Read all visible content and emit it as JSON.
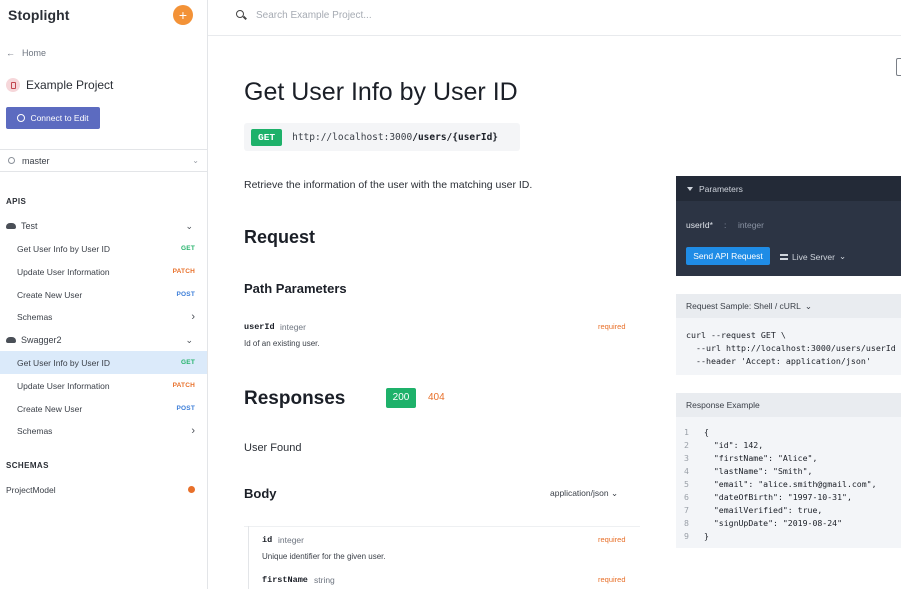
{
  "sidebar": {
    "brand": "Stoplight",
    "add_label": "+",
    "home_label": "Home",
    "project_name": "Example Project",
    "connect_label": "Connect to Edit",
    "branch": "master",
    "apis_heading": "APIS",
    "schemas_heading": "SCHEMAS",
    "groups": [
      {
        "name": "Test",
        "items": [
          {
            "label": "Get User Info by User ID",
            "method": "GET"
          },
          {
            "label": "Update User Information",
            "method": "PATCH"
          },
          {
            "label": "Create New User",
            "method": "POST"
          },
          {
            "label": "Schemas",
            "method": ""
          }
        ]
      },
      {
        "name": "Swagger2",
        "items": [
          {
            "label": "Get User Info by User ID",
            "method": "GET"
          },
          {
            "label": "Update User Information",
            "method": "PATCH"
          },
          {
            "label": "Create New User",
            "method": "POST"
          },
          {
            "label": "Schemas",
            "method": ""
          }
        ]
      }
    ],
    "models": [
      {
        "label": "ProjectModel"
      }
    ]
  },
  "search": {
    "placeholder": "Search Example Project..."
  },
  "main": {
    "title": "Get User Info by User ID",
    "method": "GET",
    "url_base": "http://localhost:3000",
    "url_path": "/users/{userId}",
    "description": "Retrieve the information of the user with the matching user ID.",
    "request_heading": "Request",
    "path_params_heading": "Path Parameters",
    "param": {
      "name": "userId",
      "type": "integer",
      "required": "required",
      "description": "Id of an existing user."
    },
    "responses_heading": "Responses",
    "codes": [
      "200",
      "404"
    ],
    "response_description": "User Found",
    "body_heading": "Body",
    "content_type": "application/json",
    "fields": [
      {
        "name": "id",
        "type": "integer",
        "required": "required",
        "description": "Unique identifier for the given user."
      },
      {
        "name": "firstName",
        "type": "string",
        "required": "required",
        "description": ""
      }
    ]
  },
  "right": {
    "params_panel": {
      "title": "Parameters",
      "param_name": "userId*",
      "separator": ":",
      "param_type": "integer",
      "send_label": "Send API Request",
      "server_label": "Live Server"
    },
    "request_sample": {
      "title": "Request Sample: Shell / cURL",
      "lines": [
        "curl --request GET \\",
        "  --url http://localhost:3000/users/userId",
        "  --header 'Accept: application/json'"
      ]
    },
    "response_example": {
      "title": "Response Example",
      "lines": [
        {
          "n": "1",
          "t": "{"
        },
        {
          "n": "2",
          "t": "  \"id\": 142,"
        },
        {
          "n": "3",
          "t": "  \"firstName\": \"Alice\","
        },
        {
          "n": "4",
          "t": "  \"lastName\": \"Smith\","
        },
        {
          "n": "5",
          "t": "  \"email\": \"alice.smith@gmail.com\","
        },
        {
          "n": "6",
          "t": "  \"dateOfBirth\": \"1997-10-31\","
        },
        {
          "n": "7",
          "t": "  \"emailVerified\": true,"
        },
        {
          "n": "8",
          "t": "  \"signUpDate\": \"2019-08-24\""
        },
        {
          "n": "9",
          "t": "}"
        }
      ]
    }
  },
  "colors": {
    "accent": "#5c6bc0",
    "get": "#1eb16a",
    "patch": "#e8702a",
    "post": "#3b7dd8",
    "active_bg": "#dbeafa"
  }
}
